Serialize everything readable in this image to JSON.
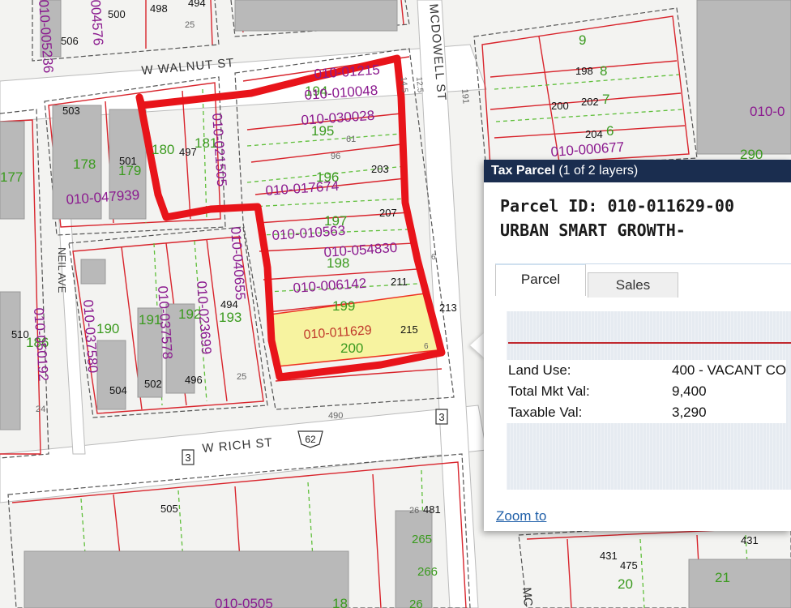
{
  "map": {
    "streets": {
      "walnut": "W WALNUT ST",
      "rich": "W RICH ST",
      "mcdowell": "MCDOWELL ST",
      "mcdowell_lower": "MC",
      "neil": "NEIL AVE",
      "route_3a": "3",
      "route_3b": "3",
      "route_62": "62"
    },
    "address_labels": [
      "506",
      "500",
      "498",
      "494",
      "503",
      "501",
      "497",
      "198",
      "200",
      "202",
      "204",
      "203",
      "207",
      "211",
      "213",
      "215",
      "510",
      "504",
      "502",
      "496",
      "494",
      "490",
      "505",
      "481",
      "431",
      "475",
      "431",
      "191",
      "12.5",
      "14.5",
      "96",
      "61",
      "25",
      "24",
      "26",
      "25",
      "6",
      "6"
    ],
    "lot_labels": [
      "9",
      "8",
      "7",
      "6",
      "290",
      "178",
      "179",
      "180",
      "181",
      "194",
      "195",
      "196",
      "197",
      "198",
      "199",
      "200",
      "190",
      "191",
      "192",
      "193",
      "186",
      "177",
      "265",
      "266",
      "20",
      "21",
      "18",
      "26"
    ],
    "parcel_ids": [
      "010-01215",
      "010-010048",
      "010-030028",
      "010-017674",
      "010-010563",
      "010-054830",
      "010-006142",
      "010-011629",
      "010-047939",
      "010-021505",
      "010-040655",
      "010-037580",
      "010-037578",
      "010-023699",
      "010-050192",
      "010-000677",
      "010-0",
      "010-005236",
      "004576",
      "010-0505"
    ],
    "highlight_color": "#f7f3a0",
    "annotation_color": "#e8141a",
    "parcel_color": "#8b1a8f",
    "lot_color": "#3a9a1e"
  },
  "popup": {
    "header_title": "Tax Parcel",
    "header_sub": "(1 of 2 layers)",
    "parcel_id": "Parcel ID: 010-011629-00",
    "owner": "URBAN SMART GROWTH-",
    "tabs": [
      "Parcel",
      "Sales"
    ],
    "attributes": [
      {
        "key": "Land Use:",
        "value": "400 - VACANT CO"
      },
      {
        "key": "Total Mkt Val:",
        "value": "9,400"
      },
      {
        "key": "Taxable Val:",
        "value": "3,290"
      }
    ],
    "zoom_link": "Zoom to"
  }
}
